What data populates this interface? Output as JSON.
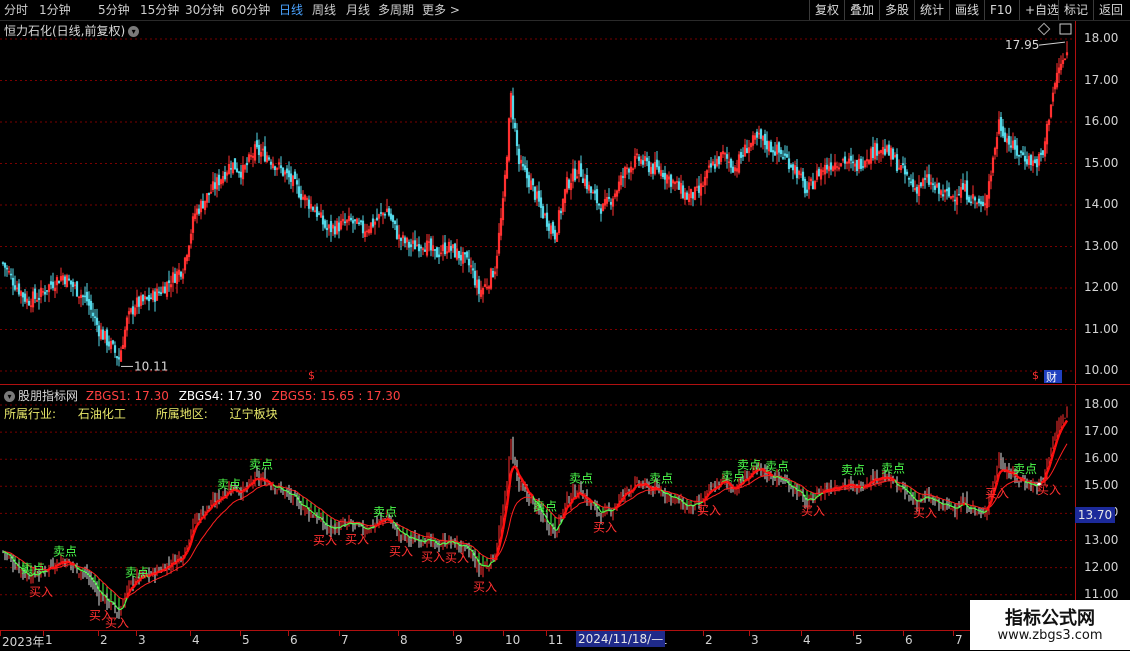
{
  "toolbar": {
    "periods": [
      "分时",
      "1分钟",
      "5分钟",
      "15分钟",
      "30分钟",
      "60分钟",
      "日线",
      "周线",
      "月线",
      "多周期",
      "更多 >"
    ],
    "active_period": "日线",
    "actions": [
      "复权",
      "叠加",
      "多股",
      "统计",
      "画线",
      "F10",
      "+自选",
      "标记",
      "返回"
    ]
  },
  "main_chart": {
    "title": "恒力石化(日线,前复权)",
    "high_marker": "17.95",
    "low_marker": "10.11",
    "price_axis": [
      "18.00",
      "17.00",
      "16.00",
      "15.00",
      "14.00",
      "13.00",
      "12.00",
      "11.00",
      "10.00"
    ],
    "event_marker": "$",
    "finance_badge": "财"
  },
  "indicator": {
    "name": "股朋指标网",
    "zbgs1_label": "ZBGS1: 17.30",
    "zbgs4_label": "ZBGS4: 17.30",
    "zbgs5_label": "ZBGS5: 15.65 : 17.30",
    "industry_label": "所属行业:",
    "industry_value": "石油化工",
    "region_label": "所属地区:",
    "region_value": "辽宁板块",
    "price_axis": [
      "18.00",
      "17.00",
      "16.00",
      "15.00",
      "14.00",
      "13.00",
      "12.00",
      "11.00"
    ],
    "current_price": "13.70",
    "buy_label": "买入",
    "sell_label": "卖点"
  },
  "date_axis": {
    "labels": [
      "2023年",
      "1",
      "2",
      "3",
      "4",
      "5",
      "6",
      "7",
      "8",
      "9",
      "10",
      "11",
      "1",
      "2",
      "3",
      "4",
      "5",
      "6",
      "7"
    ],
    "cursor_date": "2024/11/18/—"
  },
  "watermark": {
    "line1": "指标公式网",
    "line2": "www.zbgs3.com"
  },
  "colors": {
    "up": "#ff3030",
    "down": "#54d8e8",
    "band_green": "#4cff4c",
    "grid": "#7a0000",
    "axis": "#b01010",
    "highlight": "#1c2a9a"
  },
  "chart_data": {
    "type": "candlestick",
    "x_range": [
      "2023-01",
      "2024-07"
    ],
    "ylim": [
      10.0,
      18.0
    ],
    "close_path": [
      {
        "idx": 0,
        "close": 12.6
      },
      {
        "idx": 6,
        "close": 12.1
      },
      {
        "idx": 12,
        "close": 11.7
      },
      {
        "idx": 18,
        "close": 11.8
      },
      {
        "idx": 24,
        "close": 12.1
      },
      {
        "idx": 30,
        "close": 12.3
      },
      {
        "idx": 36,
        "close": 12.0
      },
      {
        "idx": 42,
        "close": 11.7
      },
      {
        "idx": 48,
        "close": 11.0
      },
      {
        "idx": 54,
        "close": 10.6
      },
      {
        "idx": 58,
        "close": 10.3
      },
      {
        "idx": 62,
        "close": 11.2
      },
      {
        "idx": 66,
        "close": 11.6
      },
      {
        "idx": 72,
        "close": 11.7
      },
      {
        "idx": 78,
        "close": 11.9
      },
      {
        "idx": 84,
        "close": 12.2
      },
      {
        "idx": 90,
        "close": 12.5
      },
      {
        "idx": 96,
        "close": 13.8
      },
      {
        "idx": 102,
        "close": 14.2
      },
      {
        "idx": 108,
        "close": 14.6
      },
      {
        "idx": 114,
        "close": 15.0
      },
      {
        "idx": 120,
        "close": 14.8
      },
      {
        "idx": 126,
        "close": 15.3
      },
      {
        "idx": 132,
        "close": 15.2
      },
      {
        "idx": 138,
        "close": 14.9
      },
      {
        "idx": 144,
        "close": 14.6
      },
      {
        "idx": 150,
        "close": 14.2
      },
      {
        "idx": 156,
        "close": 13.9
      },
      {
        "idx": 162,
        "close": 13.4
      },
      {
        "idx": 168,
        "close": 13.5
      },
      {
        "idx": 174,
        "close": 13.6
      },
      {
        "idx": 180,
        "close": 13.4
      },
      {
        "idx": 186,
        "close": 13.6
      },
      {
        "idx": 192,
        "close": 13.9
      },
      {
        "idx": 198,
        "close": 13.2
      },
      {
        "idx": 204,
        "close": 13.0
      },
      {
        "idx": 210,
        "close": 13.1
      },
      {
        "idx": 216,
        "close": 12.8
      },
      {
        "idx": 222,
        "close": 13.0
      },
      {
        "idx": 228,
        "close": 12.8
      },
      {
        "idx": 234,
        "close": 12.5
      },
      {
        "idx": 238,
        "close": 11.9
      },
      {
        "idx": 242,
        "close": 12.1
      },
      {
        "idx": 246,
        "close": 12.5
      },
      {
        "idx": 250,
        "close": 14.0
      },
      {
        "idx": 254,
        "close": 16.6
      },
      {
        "idx": 258,
        "close": 15.0
      },
      {
        "idx": 264,
        "close": 14.5
      },
      {
        "idx": 270,
        "close": 13.8
      },
      {
        "idx": 276,
        "close": 13.3
      },
      {
        "idx": 282,
        "close": 14.5
      },
      {
        "idx": 288,
        "close": 14.9
      },
      {
        "idx": 294,
        "close": 14.3
      },
      {
        "idx": 300,
        "close": 13.9
      },
      {
        "idx": 306,
        "close": 14.3
      },
      {
        "idx": 312,
        "close": 14.9
      },
      {
        "idx": 318,
        "close": 15.1
      },
      {
        "idx": 324,
        "close": 14.9
      },
      {
        "idx": 330,
        "close": 14.8
      },
      {
        "idx": 336,
        "close": 14.5
      },
      {
        "idx": 342,
        "close": 14.2
      },
      {
        "idx": 348,
        "close": 14.3
      },
      {
        "idx": 354,
        "close": 14.9
      },
      {
        "idx": 360,
        "close": 15.2
      },
      {
        "idx": 366,
        "close": 14.9
      },
      {
        "idx": 372,
        "close": 15.4
      },
      {
        "idx": 378,
        "close": 15.6
      },
      {
        "idx": 384,
        "close": 15.4
      },
      {
        "idx": 390,
        "close": 15.2
      },
      {
        "idx": 396,
        "close": 14.9
      },
      {
        "idx": 402,
        "close": 14.3
      },
      {
        "idx": 408,
        "close": 14.8
      },
      {
        "idx": 414,
        "close": 15.0
      },
      {
        "idx": 420,
        "close": 15.1
      },
      {
        "idx": 426,
        "close": 14.9
      },
      {
        "idx": 432,
        "close": 15.2
      },
      {
        "idx": 438,
        "close": 15.4
      },
      {
        "idx": 444,
        "close": 15.2
      },
      {
        "idx": 450,
        "close": 14.8
      },
      {
        "idx": 456,
        "close": 14.4
      },
      {
        "idx": 462,
        "close": 14.6
      },
      {
        "idx": 468,
        "close": 14.3
      },
      {
        "idx": 474,
        "close": 14.2
      },
      {
        "idx": 480,
        "close": 14.4
      },
      {
        "idx": 486,
        "close": 14.1
      },
      {
        "idx": 490,
        "close": 13.9
      },
      {
        "idx": 494,
        "close": 14.8
      },
      {
        "idx": 498,
        "close": 16.0
      },
      {
        "idx": 502,
        "close": 15.6
      },
      {
        "idx": 506,
        "close": 15.3
      },
      {
        "idx": 510,
        "close": 15.2
      },
      {
        "idx": 516,
        "close": 15.0
      },
      {
        "idx": 520,
        "close": 15.2
      },
      {
        "idx": 524,
        "close": 16.5
      },
      {
        "idx": 528,
        "close": 17.3
      },
      {
        "idx": 532,
        "close": 17.6
      }
    ],
    "n_bars": 533,
    "buy_points": [
      18,
      48,
      56,
      160,
      176,
      198,
      214,
      226,
      240,
      300,
      352,
      404,
      460,
      496,
      522
    ],
    "sell_points": [
      14,
      30,
      66,
      112,
      128,
      190,
      270,
      288,
      328,
      364,
      372,
      386,
      424,
      444,
      510
    ]
  }
}
